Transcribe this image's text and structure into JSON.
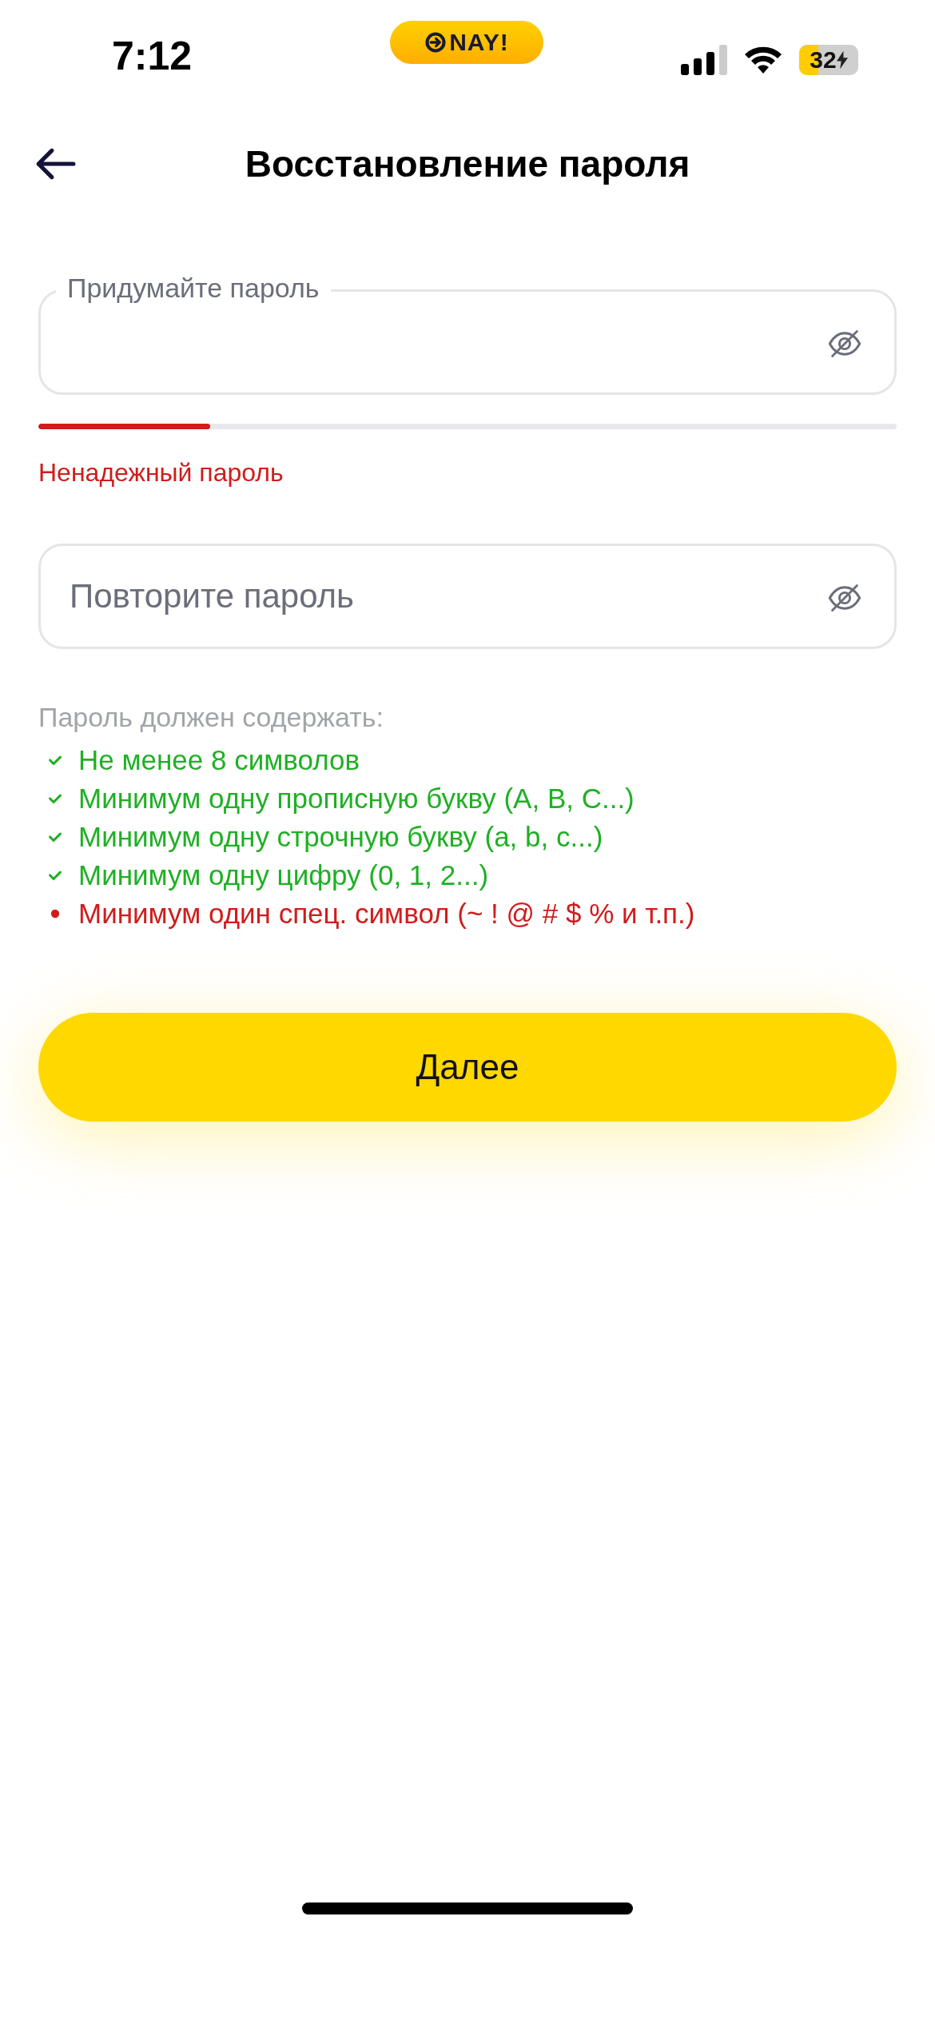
{
  "status_bar": {
    "time": "7:12",
    "logo_text": "NAY!",
    "battery": "32"
  },
  "header": {
    "title": "Восстановление пароля"
  },
  "fields": [
    {
      "kind": "labeled",
      "label": "Придумайте пароль"
    },
    {
      "kind": "placeholder",
      "placeholder": "Повторите пароль"
    }
  ],
  "strength": {
    "level": 0.2,
    "text": "Ненадежный пароль"
  },
  "requirements": {
    "title": "Пароль должен содержать:",
    "items": [
      {
        "text": "Не менее 8 символов",
        "met": true
      },
      {
        "text": "Минимум одну прописную букву (A, B, C...)",
        "met": true
      },
      {
        "text": "Минимум одну строчную букву (a, b, c...)",
        "met": true
      },
      {
        "text": "Минимум одну цифру (0, 1, 2...)",
        "met": true
      },
      {
        "text": "Минимум один спец. символ (~ ! @ # $ % и т.п.)",
        "met": false
      }
    ]
  },
  "button": {
    "label": "Далее"
  }
}
